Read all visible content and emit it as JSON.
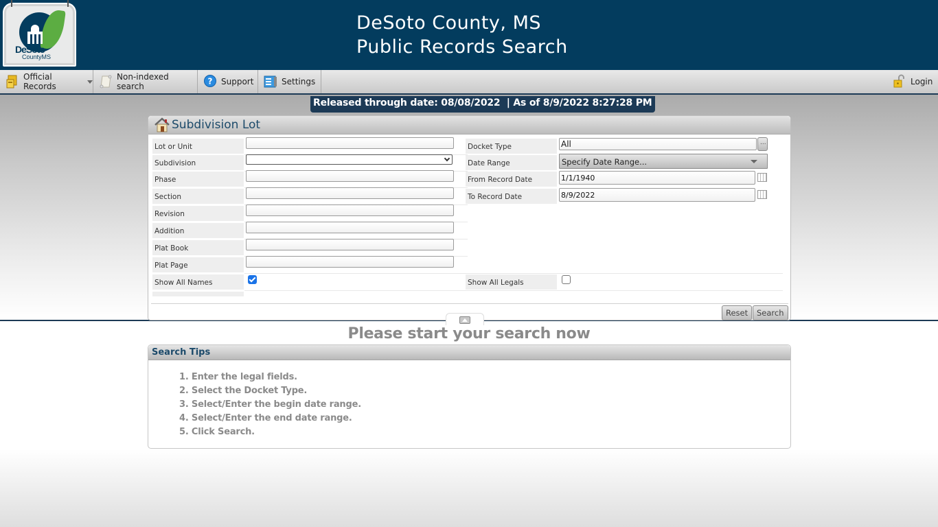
{
  "header": {
    "logo": {
      "line1": "DeSoto",
      "line2": "CountyMS"
    },
    "title_line1": "DeSoto County, MS",
    "title_line2": "Public Records Search"
  },
  "menu": {
    "items": [
      {
        "label": "Official Records",
        "icon": "records-folder-icon",
        "has_dropdown": true
      },
      {
        "label": "Non-indexed search",
        "icon": "scroll-icon"
      },
      {
        "label": "Support",
        "icon": "help-icon"
      },
      {
        "label": "Settings",
        "icon": "settings-icon"
      }
    ],
    "login": {
      "label": "Login",
      "icon": "padlock-icon"
    }
  },
  "banner": {
    "text": "Released through date: 08/08/2022  | As of 8/9/2022 8:27:28 PM"
  },
  "search_panel": {
    "title": "Subdivision Lot",
    "left_fields": [
      {
        "label": "Lot or Unit",
        "value": ""
      },
      {
        "label": "Subdivision",
        "value": ""
      },
      {
        "label": "Phase",
        "value": ""
      },
      {
        "label": "Section",
        "value": ""
      },
      {
        "label": "Revision",
        "value": ""
      },
      {
        "label": "Addition",
        "value": ""
      },
      {
        "label": "Plat Book",
        "value": ""
      },
      {
        "label": "Plat Page",
        "value": ""
      }
    ],
    "show_all_names": {
      "label": "Show All Names",
      "checked": true
    },
    "right_fields": {
      "docket_type": {
        "label": "Docket Type",
        "value": "All",
        "browse_label": "..."
      },
      "date_range": {
        "label": "Date Range",
        "value": "Specify Date Range..."
      },
      "from_date": {
        "label": "From Record Date",
        "value": "1/1/1940"
      },
      "to_date": {
        "label": "To Record Date",
        "value": "8/9/2022"
      }
    },
    "show_all_legals": {
      "label": "Show All Legals",
      "checked": false
    },
    "buttons": {
      "reset": "Reset",
      "search": "Search"
    }
  },
  "start_message": "Please start your search now",
  "tips": {
    "title": "Search Tips",
    "items": [
      "1. Enter the legal fields.",
      "2. Select the Docket Type.",
      "3. Select/Enter the begin date range.",
      "4. Select/Enter the end date range.",
      "5. Click Search."
    ]
  }
}
